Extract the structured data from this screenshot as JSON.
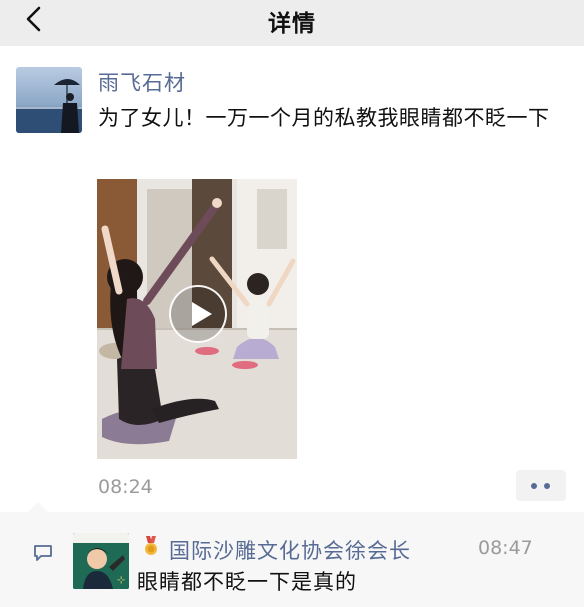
{
  "header": {
    "title": "详情",
    "back_icon": "chevron-left-icon"
  },
  "post": {
    "username": "雨飞石材",
    "text": "为了女儿！一万一个月的私教我眼睛都不眨一下",
    "media_type": "video",
    "play_icon": "play-icon",
    "time": "08:24",
    "more_icon": "more-dots-icon"
  },
  "comment": {
    "icon": "comment-bubble-icon",
    "badge_icon": "medal-icon",
    "name": "国际沙雕文化协会徐会长",
    "time": "08:47",
    "text": "眼睛都不眨一下是真的"
  },
  "colors": {
    "link": "#576b95",
    "topbar_bg": "#ededed",
    "comment_bg": "#f7f7f7",
    "meta_text": "#9b9b9b"
  }
}
